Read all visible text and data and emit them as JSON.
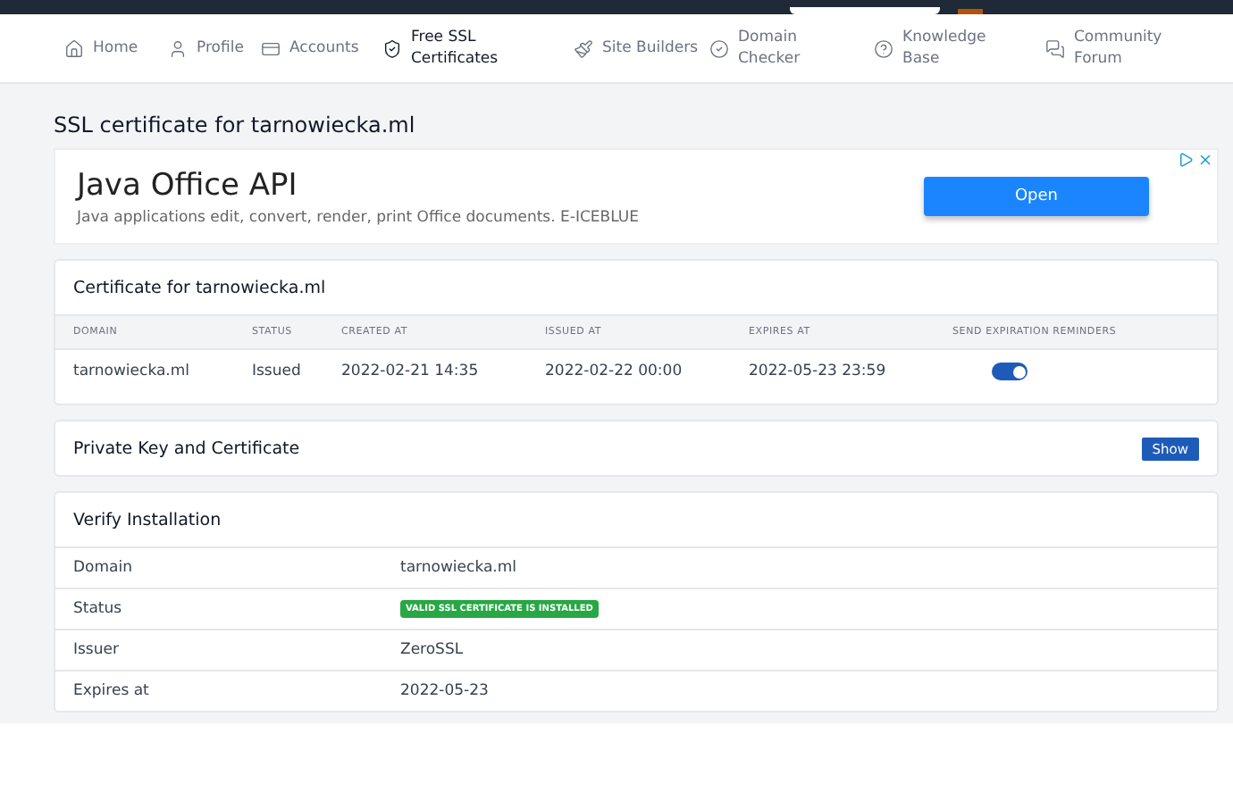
{
  "nav": [
    {
      "label": "Home",
      "selected": false
    },
    {
      "label": "Profile",
      "selected": false
    },
    {
      "label": "Accounts",
      "selected": false
    },
    {
      "label": "Free SSL Certificates",
      "selected": true
    },
    {
      "label": "Site Builders",
      "selected": false
    },
    {
      "label": "Domain Checker",
      "selected": false
    },
    {
      "label": "Knowledge Base",
      "selected": false
    },
    {
      "label": "Community Forum",
      "selected": false
    }
  ],
  "page_title": "SSL certificate for tarnowiecka.ml",
  "ad": {
    "title": "Java Office API",
    "text": "Java applications edit, convert, render, print Office documents. E-ICEBLUE",
    "button": "Open"
  },
  "certificate": {
    "title": "Certificate for tarnowiecka.ml",
    "columns": [
      "DOMAIN",
      "STATUS",
      "CREATED AT",
      "ISSUED AT",
      "EXPIRES AT",
      "SEND EXPIRATION REMINDERS"
    ],
    "rows": [
      {
        "cells": [
          "tarnowiecka.ml",
          "Issued",
          "2022-02-21 14:35",
          "2022-02-22 00:00",
          "2022-05-23 23:59"
        ],
        "reminders_on": true
      }
    ]
  },
  "private_key": {
    "title": "Private Key and Certificate",
    "button": "Show"
  },
  "verify": {
    "title": "Verify Installation",
    "rows": [
      {
        "label": "Domain",
        "value": "tarnowiecka.ml",
        "kind": "text"
      },
      {
        "label": "Status",
        "value": "VALID SSL CERTIFICATE IS INSTALLED",
        "kind": "badge"
      },
      {
        "label": "Issuer",
        "value": "ZeroSSL",
        "kind": "text"
      },
      {
        "label": "Expires at",
        "value": "2022-05-23",
        "kind": "text"
      }
    ]
  }
}
